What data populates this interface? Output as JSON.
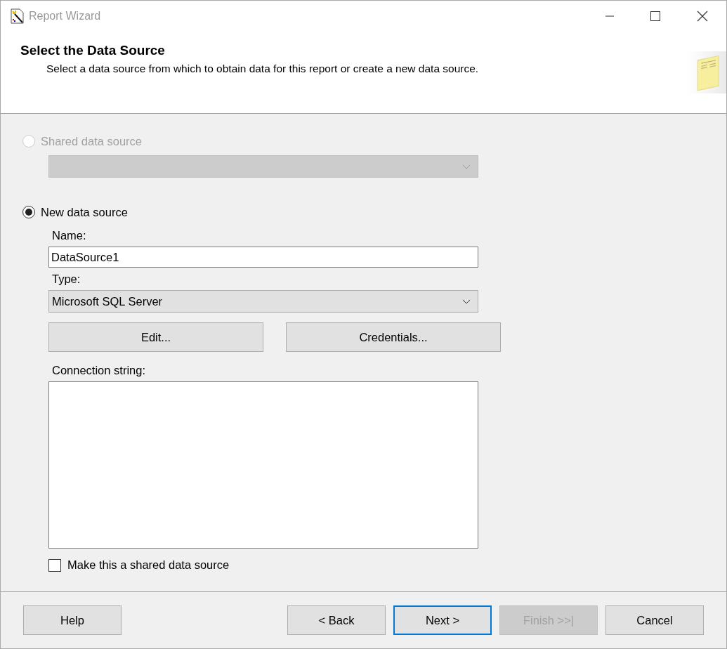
{
  "window": {
    "title": "Report Wizard"
  },
  "header": {
    "title": "Select the Data Source",
    "subtitle": "Select a data source from which to obtain data for this report or create a new data source."
  },
  "options": [
    {
      "label": "Shared data source",
      "selected": false,
      "disabled": true
    },
    {
      "label": "New data source",
      "selected": true,
      "disabled": false
    }
  ],
  "shared_dropdown": {
    "disabled": true
  },
  "name": {
    "label": "Name:",
    "value": "DataSource1"
  },
  "type": {
    "label": "Type:",
    "value": "Microsoft SQL Server"
  },
  "action_buttons": [
    {
      "label": "Edit..."
    },
    {
      "label": "Credentials..."
    }
  ],
  "connection_string": {
    "label": "Connection string:"
  },
  "make_shared": {
    "label": "Make this a shared data source",
    "checked": false
  },
  "footer_buttons": [
    {
      "label": "Help",
      "disabled": false,
      "default": false
    },
    {
      "label": "< Back",
      "disabled": false,
      "default": false
    },
    {
      "label": "Next >",
      "disabled": false,
      "default": true
    },
    {
      "label": "Finish >>|",
      "disabled": true,
      "default": false
    },
    {
      "label": "Cancel",
      "disabled": false,
      "default": false
    }
  ]
}
